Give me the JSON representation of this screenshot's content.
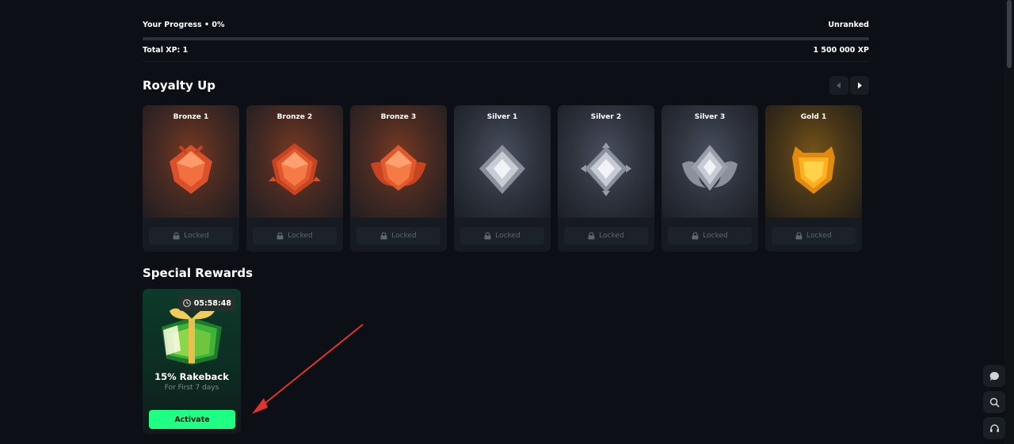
{
  "progress": {
    "label": "Your Progress • 0%",
    "percent": 0,
    "rank": "Unranked",
    "total_xp": "Total XP: 1",
    "max_xp": "1 500 000 XP"
  },
  "royalty": {
    "title": "Royalty Up",
    "tiers": [
      {
        "name": "Bronze 1",
        "status": "Locked",
        "tier": "bronze"
      },
      {
        "name": "Bronze 2",
        "status": "Locked",
        "tier": "bronze"
      },
      {
        "name": "Bronze 3",
        "status": "Locked",
        "tier": "bronze"
      },
      {
        "name": "Silver 1",
        "status": "Locked",
        "tier": "silver"
      },
      {
        "name": "Silver 2",
        "status": "Locked",
        "tier": "silver"
      },
      {
        "name": "Silver 3",
        "status": "Locked",
        "tier": "silver"
      },
      {
        "name": "Gold 1",
        "status": "Locked",
        "tier": "gold"
      }
    ]
  },
  "special": {
    "title": "Special Rewards",
    "reward": {
      "timer": "05:58:48",
      "title": "15% Rakeback",
      "subtitle": "For First 7 days",
      "button": "Activate"
    }
  },
  "colors": {
    "accent": "#1fff84",
    "annotation_arrow": "#e0342c"
  },
  "icons": [
    "prev-arrow-icon",
    "next-arrow-icon",
    "lock-icon",
    "clock-icon",
    "chat-icon",
    "search-icon",
    "headset-icon"
  ]
}
